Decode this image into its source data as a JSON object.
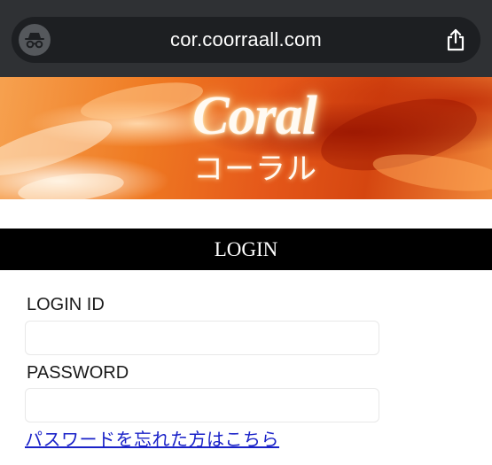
{
  "browser": {
    "url": "cor.coorraall.com",
    "privacy_icon": "incognito-icon",
    "share_icon": "share-icon"
  },
  "banner": {
    "logo_en": "Coral",
    "logo_ja": "コーラル",
    "colors": {
      "primary": "#ef7a22",
      "dark": "#a51e05",
      "light": "#ffd6a8"
    }
  },
  "login": {
    "title": "LOGIN",
    "login_id_label": "LOGIN ID",
    "login_id_value": "",
    "password_label": "PASSWORD",
    "password_value": "",
    "forgot_link": "パスワードを忘れた方はこちら"
  }
}
